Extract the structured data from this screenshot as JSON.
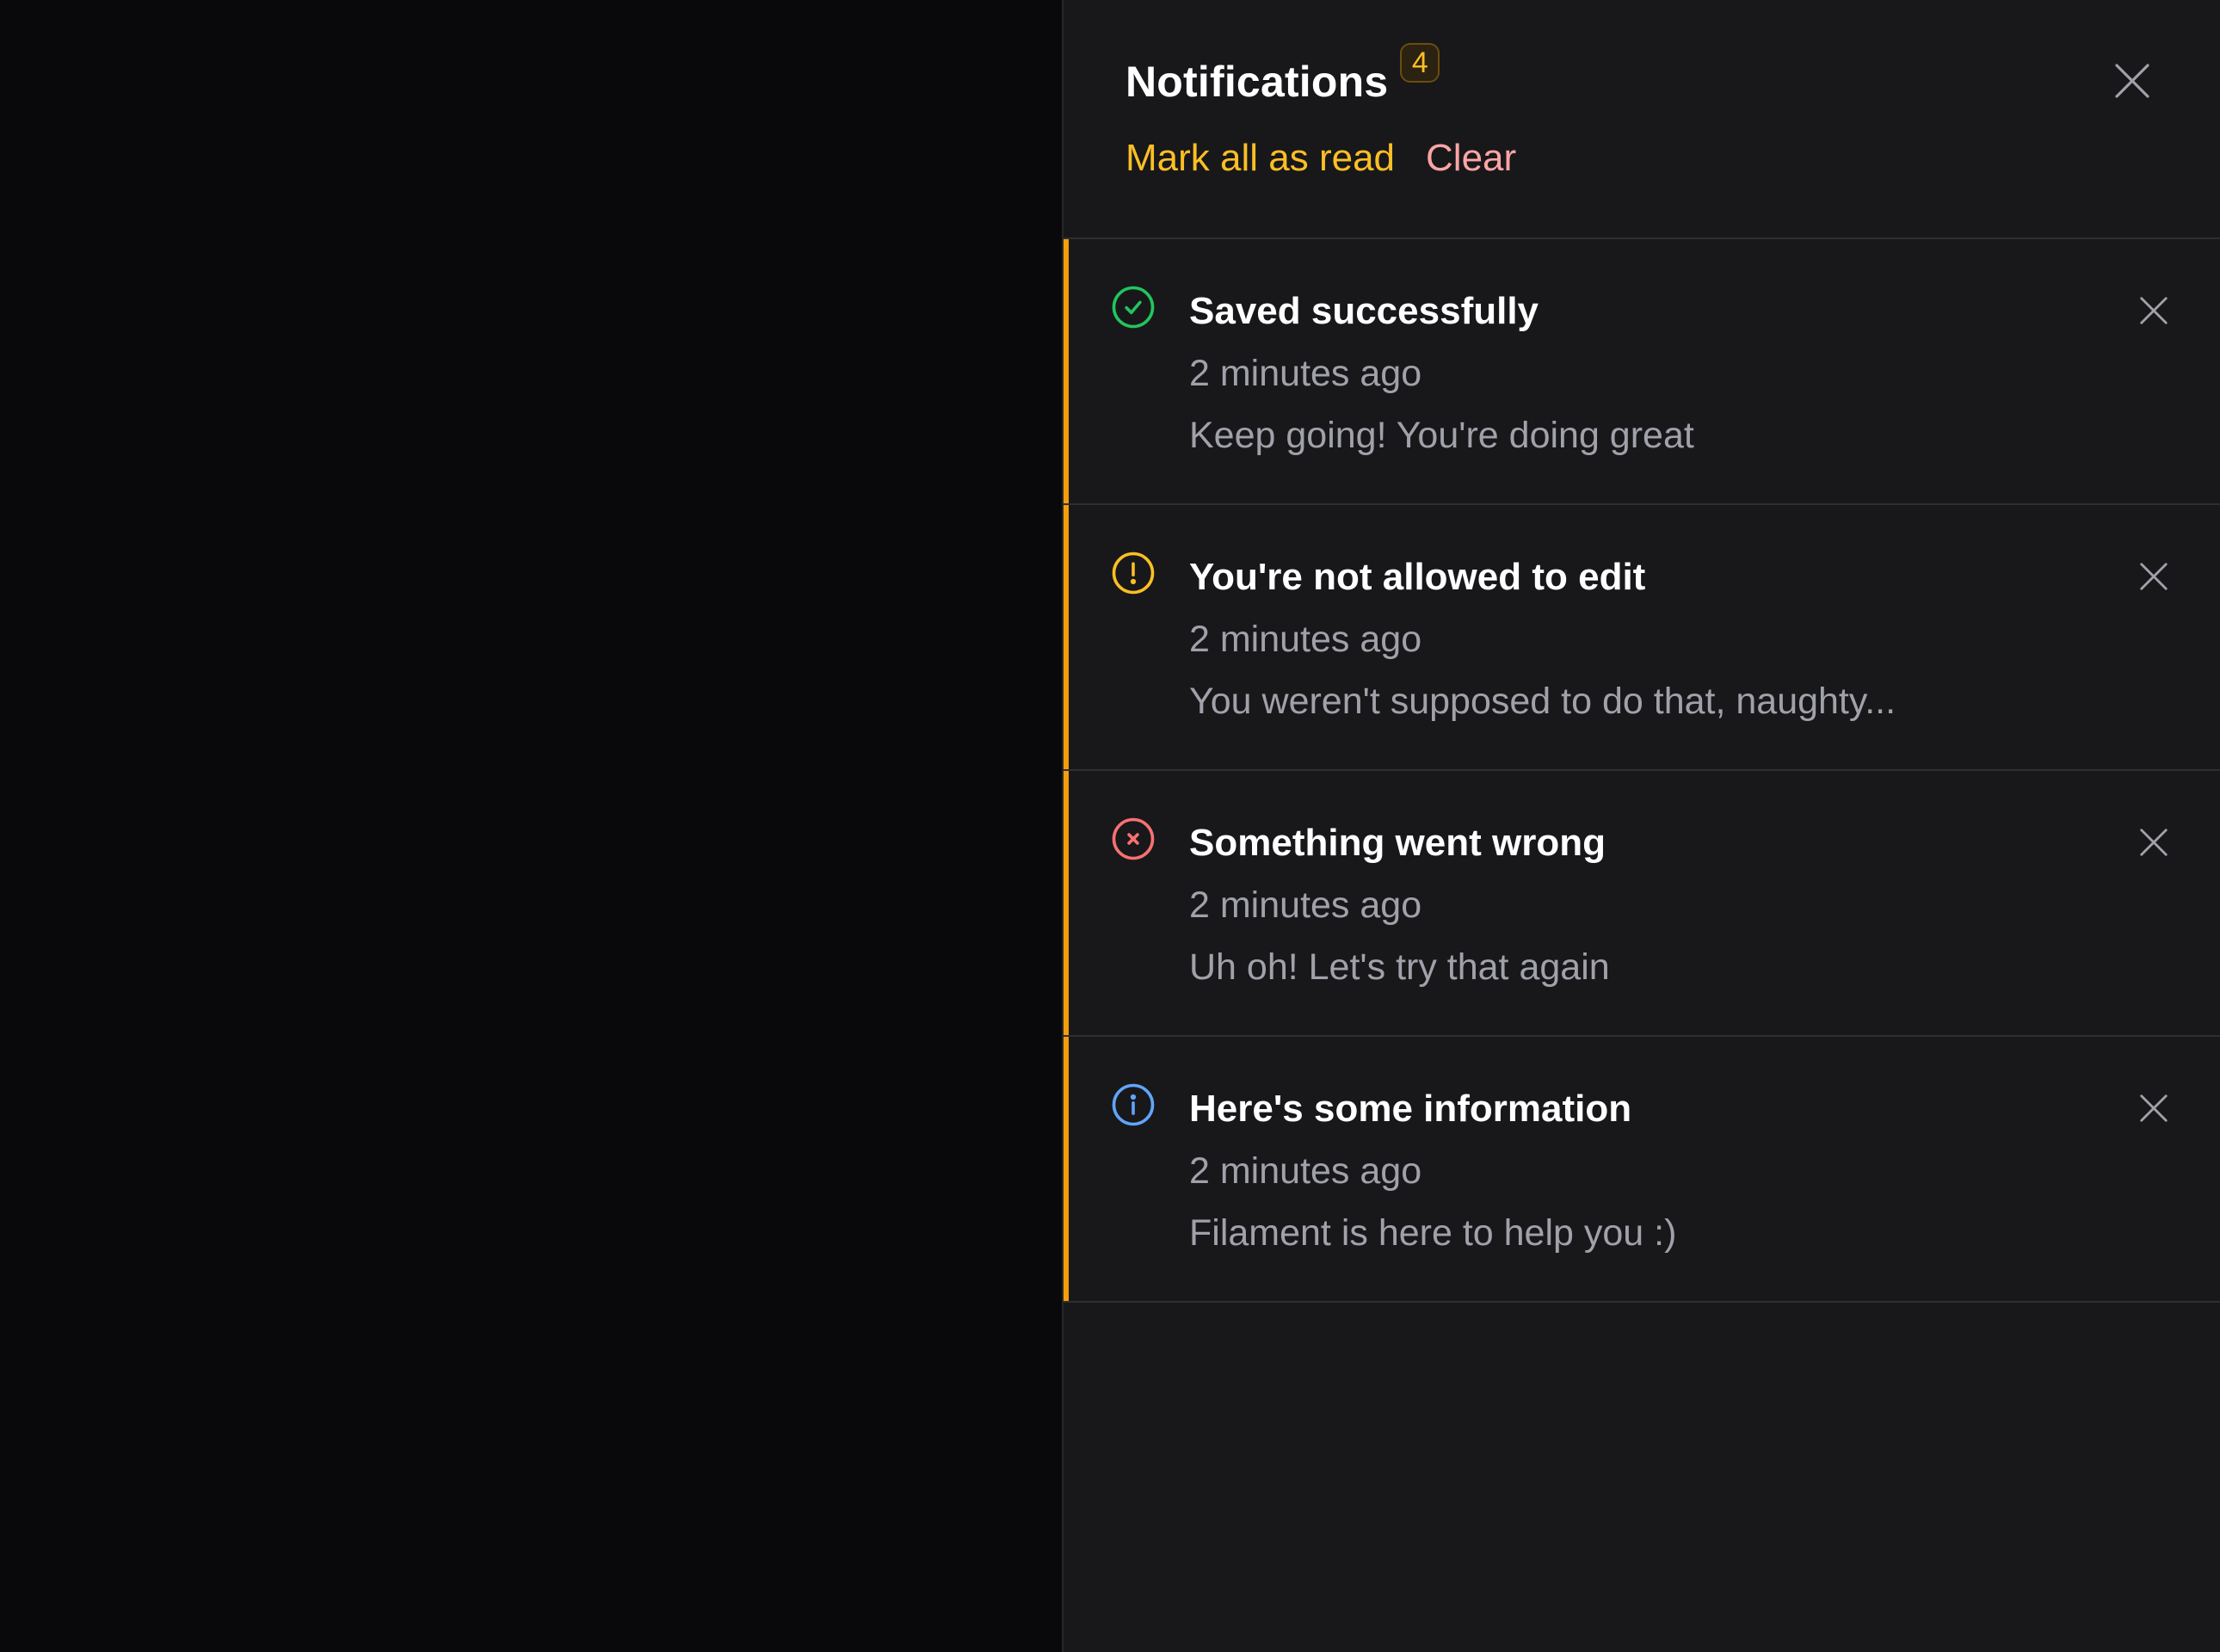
{
  "panel": {
    "title": "Notifications",
    "unread_count": "4",
    "actions": {
      "mark_all_read": "Mark all as read",
      "clear": "Clear"
    },
    "accent_color": "#f59e0b"
  },
  "notifications": [
    {
      "status": "success",
      "icon": "check-circle-icon",
      "icon_color": "#22c55e",
      "title": "Saved successfully",
      "time": "2 minutes ago",
      "body": "Keep going! You're doing great"
    },
    {
      "status": "warning",
      "icon": "exclamation-circle-icon",
      "icon_color": "#fbbf24",
      "title": "You're not allowed to edit",
      "time": "2 minutes ago",
      "body": "You weren't supposed to do that, naughty..."
    },
    {
      "status": "danger",
      "icon": "x-circle-icon",
      "icon_color": "#f87171",
      "title": "Something went wrong",
      "time": "2 minutes ago",
      "body": "Uh oh! Let's try that again"
    },
    {
      "status": "info",
      "icon": "information-circle-icon",
      "icon_color": "#60a5fa",
      "title": "Here's some information",
      "time": "2 minutes ago",
      "body": "Filament is here to help you :)"
    }
  ]
}
